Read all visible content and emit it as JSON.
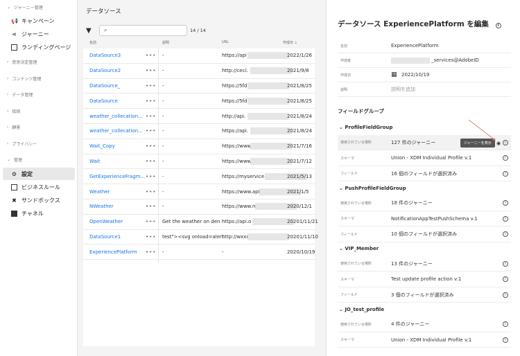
{
  "sidebar": {
    "journey_section": "ジャーニー管理",
    "campaign": "キャンペーン",
    "journey": "ジャーニー",
    "landing": "ランディングページ",
    "sections": [
      "意思決定管理",
      "コンテンツ管理",
      "データ管理",
      "接続",
      "顧客",
      "プライバシー"
    ],
    "admin_section": "管理",
    "settings": "設定",
    "business_rules": "ビジネスルール",
    "sandbox": "サンドボックス",
    "channels": "チャネル"
  },
  "list": {
    "title": "データソース",
    "search_placeholder": "",
    "count": "14 / 14",
    "columns": [
      "名前",
      "説明",
      "URL",
      "作成日 ↓"
    ],
    "rows": [
      [
        "DataSource3",
        "-",
        "https://api",
        "2022/1/26"
      ],
      [
        "DataSource2",
        "-",
        "http://ceci.",
        "2021/9/8"
      ],
      [
        "DataSource_",
        "-",
        "https://5fd",
        "2021/8/25"
      ],
      [
        "DataSource",
        "-",
        "https://5fd",
        "2021/8/25"
      ],
      [
        "weather_collecation...",
        "-",
        "http://api.",
        "2021/8/24"
      ],
      [
        "weather_collecation...",
        "-",
        "https://api.",
        "2021/8/24"
      ],
      [
        "Wait_Copy",
        "-",
        "https://www.",
        "2021/7/16"
      ],
      [
        "Wait",
        "-",
        "https://www.",
        "2021/7/12"
      ],
      [
        "GetExperienceFragm...",
        "-",
        "https://myservice.com/",
        "2021/5/13"
      ],
      [
        "Weather",
        "-",
        "https://www.api.",
        "2021/1/5"
      ],
      [
        "NWeather",
        "-",
        "https://www.me",
        "2020/12/1"
      ],
      [
        "OpenWeather",
        "Get the weather on den",
        "https://api.o",
        "20201/11/21"
      ],
      [
        "DataSource1",
        "test\"><svg onload=alert",
        "http://wxxd",
        "20201/11/10"
      ],
      [
        "ExperiencePlatform",
        "-",
        "-",
        "2020/10/19"
      ]
    ]
  },
  "detail": {
    "title": "データソース ExperiencePlatform を編集",
    "fields": [
      [
        "名前",
        "ExperiencePlatform"
      ],
      [
        "作成者",
        "_services@AdobeID"
      ],
      [
        "作成日",
        "2022/10/19"
      ],
      [
        "説明",
        "説明を追加"
      ]
    ],
    "field_groups_title": "フィールドグループ",
    "tooltip": "ジャーニーを表示",
    "groups": [
      {
        "name": "ProfileFieldGroup",
        "rows": [
          [
            "使用されている場所",
            "127 件のジャーニー"
          ],
          [
            "スキーマ",
            "Union - XDM Individual Profile v.1"
          ],
          [
            "フィールド",
            "16 個のフィールドが選択済み"
          ]
        ]
      },
      {
        "name": "PushProfileFieldGroup",
        "rows": [
          [
            "使用されている場所",
            "18 件のジャーニー"
          ],
          [
            "スキーマ",
            "NotificationAppTestPushSchema v.1"
          ],
          [
            "フィールド",
            "10 個のフィールドが選択済み"
          ]
        ]
      },
      {
        "name": "VIP_Member",
        "rows": [
          [
            "使用されている場所",
            "13 件のジャーニー"
          ],
          [
            "スキーマ",
            "Test update profile action v.1"
          ],
          [
            "フィールド",
            "3 個のフィールドが選択済み"
          ]
        ]
      },
      {
        "name": "JO_test_profile",
        "rows": [
          [
            "使用されている場所",
            "4 件のジャーニー"
          ],
          [
            "スキーマ",
            "Union - XDM Individual Profile v.1"
          ]
        ]
      }
    ]
  }
}
